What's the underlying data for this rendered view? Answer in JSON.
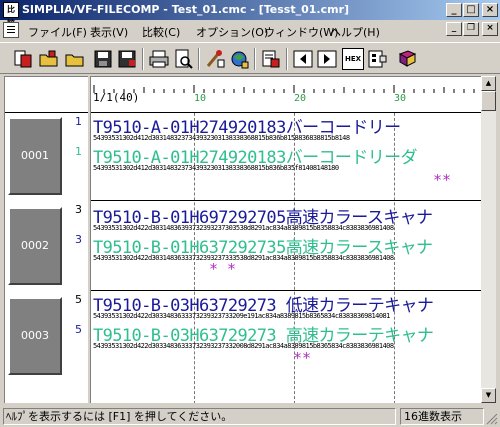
{
  "window": {
    "title": "SIMPLIA/VF-FILECOMP - Test_01.cmc - [Tesst_01.cmr]",
    "app_icon_text": "比較",
    "controls": {
      "minimize": "_",
      "maximize": "□",
      "close": "×"
    }
  },
  "menu": [
    {
      "label": "ファイル(F)"
    },
    {
      "label": "表示(V)"
    },
    {
      "label": "比較(C)"
    },
    {
      "label": "オプション(O)"
    },
    {
      "label": "ウィンドウ(W)"
    },
    {
      "label": "ヘルプ(H)"
    }
  ],
  "toolbar": {
    "icons": [
      "new-compare-icon",
      "open-folder-icon",
      "open-file-icon",
      "save-icon",
      "save-as-icon",
      "print-icon",
      "print-preview-icon",
      "run-compare-icon",
      "settings-icon",
      "delete-icon",
      "prev-diff-icon",
      "next-diff-icon",
      "hex-display-icon",
      "options-icon",
      "help-book-icon"
    ],
    "hex_label": "HEX"
  },
  "ruler": {
    "origin": "1/1(40)",
    "numbers": [
      "10",
      "20",
      "30"
    ]
  },
  "records": [
    {
      "id": "0001",
      "old_row": "1",
      "new_row": "1",
      "old_text": "T9510-A-01H274920183バーコードリー",
      "old_hex": "54393531302d412d3031483237343932303138338368815b836b8158836838815b8148",
      "new_text": "T9510-A-01H274920183バーコードリーダ",
      "new_hex": "54393531302d412d3031483237343932303138338368815b836b835f81408148180",
      "diff_marks": "**"
    },
    {
      "id": "0002",
      "old_row": "3",
      "new_row": "3",
      "old_text": "T9510-B-01H697292705高速カラースキャナ",
      "old_hex": "54393531302d422d30314836393732393237303538d8291ac834a8389815b8358834c8383836981408",
      "new_text": "T9510-B-01H637292735高速カラースキャナ",
      "new_hex": "54393531302d422d30314836333732393237333538d8291ac834a8389815b8358834c8383836981408",
      "diff_marks": "*    *"
    },
    {
      "id": "0003",
      "old_row": "5",
      "new_row": "5",
      "old_text": "T9510-B-03H63729273 低速カラーテキャナ",
      "old_hex": "54393531302d422d3033483633373239323733209e191ac834a8389815b8365834c83838369814081",
      "new_text": "T9510-B-03H63729273 高速カラーテキャナ",
      "new_hex": "54393531302d422d30334836333732393237332008d8291ac834a8389815b8365834c8383836981408",
      "diff_marks": "**"
    }
  ],
  "status": {
    "message": "ﾍﾙﾌﾟを表示するには [F1] を押してください。",
    "mode": "16進数表示"
  },
  "colors": {
    "old_text": "#1a1a9a",
    "new_text": "#2fbf8f",
    "diff_mark": "#b030c0",
    "title_gradient_start": "#0a246a"
  }
}
